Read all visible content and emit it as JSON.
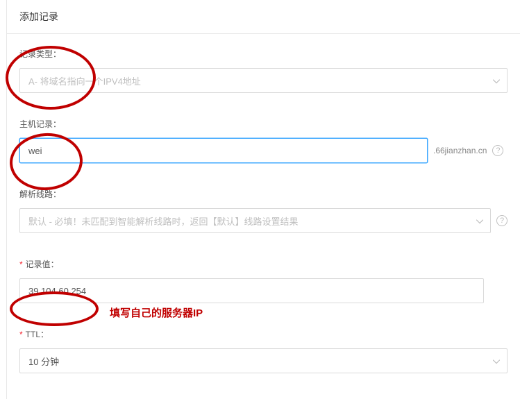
{
  "header": {
    "title": "添加记录"
  },
  "fields": {
    "type": {
      "label": "记录类型：",
      "value": "A- 将域名指向一个IPV4地址"
    },
    "host": {
      "label": "主机记录：",
      "value": "wei",
      "suffix": ".66jianzhan.cn"
    },
    "line": {
      "label": "解析线路：",
      "value": "默认 - 必填！未匹配到智能解析线路时，返回【默认】线路设置结果"
    },
    "value": {
      "label": "记录值：",
      "value": "39.104.60.254"
    },
    "ttl": {
      "label": "TTL：",
      "value": "10 分钟"
    }
  },
  "annotation": {
    "ip_hint": "填写自己的服务器IP"
  }
}
